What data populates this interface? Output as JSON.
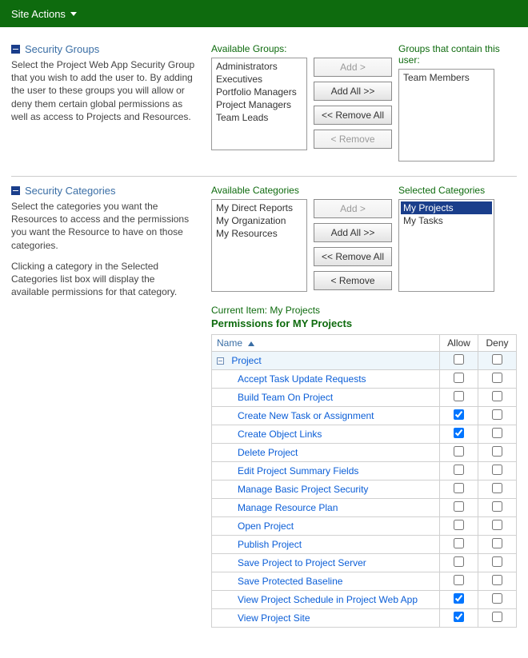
{
  "ribbon": {
    "site_actions": "Site Actions"
  },
  "sections": {
    "groups": {
      "heading": "Security Groups",
      "desc": "Select the Project Web App Security Group that you wish to add the user to. By adding the user to these groups you will allow or deny them certain global permissions as well as access to Projects and Resources.",
      "available_label": "Available Groups:",
      "selected_label": "Groups that contain this user:",
      "available": [
        "Administrators",
        "Executives",
        "Portfolio Managers",
        "Project Managers",
        "Team Leads"
      ],
      "selected": [
        "Team Members"
      ],
      "buttons": {
        "add": "Add >",
        "add_all": "Add All >>",
        "remove_all": "<< Remove All",
        "remove": "< Remove"
      }
    },
    "categories": {
      "heading": "Security Categories",
      "desc1": "Select the categories you want the Resources to access and the permissions you want the Resource to have on those categories.",
      "desc2": "Clicking a category in the Selected Categories list box will display the available permissions for that category.",
      "available_label": "Available Categories",
      "selected_label": "Selected Categories",
      "available": [
        "My Direct Reports",
        "My Organization",
        "My Resources"
      ],
      "selected": [
        "My Projects",
        "My Tasks"
      ],
      "selected_highlight": "My Projects",
      "buttons": {
        "add": "Add >",
        "add_all": "Add All >>",
        "remove_all": "<< Remove All",
        "remove": "< Remove"
      },
      "current_item_label": "Current Item:",
      "current_item_value": "My Projects",
      "perm_title": "Permissions for MY Projects",
      "columns": {
        "name": "Name",
        "allow": "Allow",
        "deny": "Deny"
      },
      "group": "Project",
      "rows": [
        {
          "label": "Accept Task Update Requests",
          "allow": false,
          "deny": false
        },
        {
          "label": "Build Team On Project",
          "allow": false,
          "deny": false
        },
        {
          "label": "Create New Task or Assignment",
          "allow": true,
          "deny": false
        },
        {
          "label": "Create Object Links",
          "allow": true,
          "deny": false
        },
        {
          "label": "Delete Project",
          "allow": false,
          "deny": false
        },
        {
          "label": "Edit Project Summary Fields",
          "allow": false,
          "deny": false
        },
        {
          "label": "Manage Basic Project Security",
          "allow": false,
          "deny": false
        },
        {
          "label": "Manage Resource Plan",
          "allow": false,
          "deny": false
        },
        {
          "label": "Open Project",
          "allow": false,
          "deny": false
        },
        {
          "label": "Publish Project",
          "allow": false,
          "deny": false
        },
        {
          "label": "Save Project to Project Server",
          "allow": false,
          "deny": false
        },
        {
          "label": "Save Protected Baseline",
          "allow": false,
          "deny": false
        },
        {
          "label": "View Project Schedule in Project Web App",
          "allow": true,
          "deny": false
        },
        {
          "label": "View Project Site",
          "allow": true,
          "deny": false
        }
      ]
    }
  }
}
